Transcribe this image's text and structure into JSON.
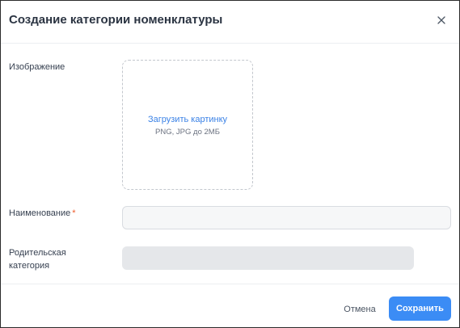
{
  "dialog": {
    "title": "Создание категории номенклатуры",
    "close_icon": "close-icon"
  },
  "form": {
    "image": {
      "label": "Изображение",
      "upload_link": "Загрузить картинку",
      "upload_hint": "PNG, JPG до 2МБ"
    },
    "name": {
      "label": "Наименование",
      "required_mark": "*",
      "value": "",
      "placeholder": ""
    },
    "parent_category": {
      "label_line1": "Родительская",
      "label_line2": "категория",
      "value": ""
    }
  },
  "footer": {
    "cancel_label": "Отмена",
    "save_label": "Сохранить"
  },
  "colors": {
    "accent": "#3b8cf5",
    "required": "#ef5b2a",
    "link": "#3b82e6"
  }
}
